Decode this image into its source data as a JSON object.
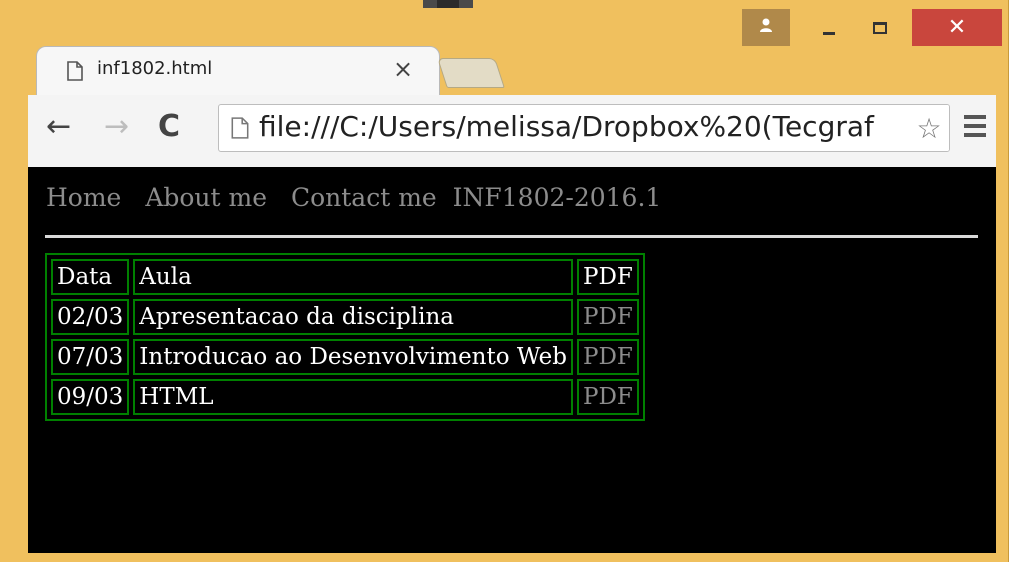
{
  "window": {
    "tab_title": "inf1802.html",
    "tab_close": "×",
    "close_glyph": "✕",
    "user_glyph": "👤"
  },
  "toolbar": {
    "back": "←",
    "forward": "→",
    "reload": "C",
    "url": "file:///C:/Users/melissa/Dropbox%20(Tecgraf",
    "star": "☆"
  },
  "site": {
    "nav": {
      "home": "Home",
      "about": "About me",
      "contact": "Contact me",
      "brand": "INF1802-2016.1"
    },
    "table": {
      "headers": {
        "data": "Data",
        "aula": "Aula",
        "pdf": "PDF"
      },
      "rows": [
        {
          "data": "02/03",
          "aula": "Apresentacao da disciplina",
          "pdf": "PDF"
        },
        {
          "data": "07/03",
          "aula": "Introducao ao Desenvolvimento Web",
          "pdf": "PDF"
        },
        {
          "data": "09/03",
          "aula": "HTML",
          "pdf": "PDF"
        }
      ]
    }
  },
  "colors": {
    "frame": "#f0c05e",
    "close_button": "#c9463d",
    "page_background": "#000000",
    "table_border": "#008000",
    "link_gray": "#8c8c8c"
  }
}
